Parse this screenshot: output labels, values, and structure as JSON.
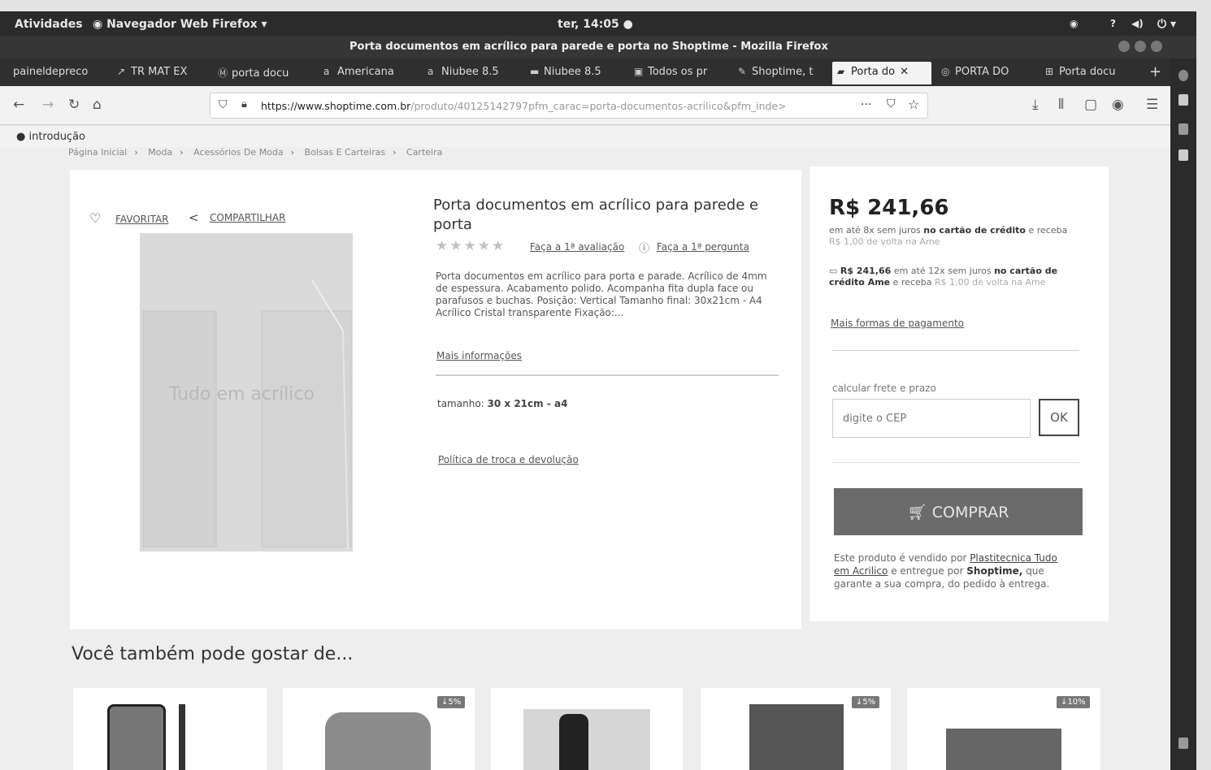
{
  "topbar": {
    "activities": "Atividades",
    "app_menu": "Navegador Web Firefox ▾",
    "clock": "ter, 14:05 ●"
  },
  "window": {
    "title": "Porta documentos em acrílico para parede e porta no Shoptime - Mozilla Firefox"
  },
  "tabs": [
    {
      "label": "paineldepreco",
      "icon": ""
    },
    {
      "label": "TR MAT EX",
      "icon": "↗"
    },
    {
      "label": "porta docu",
      "icon": "Ⓜ"
    },
    {
      "label": "Americana",
      "icon": "a"
    },
    {
      "label": "Niubee 8.5",
      "icon": "a"
    },
    {
      "label": "Niubee 8.5",
      "icon": "▬"
    },
    {
      "label": "Todos os pr",
      "icon": "▣"
    },
    {
      "label": "Shoptime, t",
      "icon": "✎"
    },
    {
      "label": "Porta do",
      "icon": "▰"
    },
    {
      "label": "PORTA DO",
      "icon": "◎"
    },
    {
      "label": "Porta docu",
      "icon": "⊞"
    }
  ],
  "navbar": {
    "url_main": "https://www.shoptime.com.br",
    "url_rest": "/produto/40125142797pfm_carac=porta-documentos-acrilico&pfm_inde>",
    "more": "···"
  },
  "bookmarks": {
    "item": "introdução"
  },
  "breadcrumb": [
    "Página Inicial",
    "Moda",
    "Acessórios De Moda",
    "Bolsas E Carteiras",
    "Carteira"
  ],
  "product": {
    "favorite": "FAVORITAR",
    "share": "COMPARTILHAR",
    "watermark": "Tudo em acrílico",
    "title": "Porta documentos em acrílico para parede e porta",
    "stars": "★★★★★",
    "review_link": "Faça a 1ª avaliação",
    "question_link": "Faça a 1ª pergunta",
    "description": "Porta documentos em acrílico para porta e parade. Acrílico de 4mm de espessura. Acabamento polido. Acompanha fita dupla face ou parafusos e buchas. Posição: Vertical Tamanho final: 30x21cm - A4 Acrílico Cristal transparente Fixação:...",
    "more_info": "Mais informações",
    "size_label": "tamanho:",
    "size_value": "30 x 21cm - a4",
    "policy": "Política de troca e devolução"
  },
  "buy": {
    "price": "R$ 241,66",
    "installments_a": "em até 8x sem juros",
    "installments_b": "no cartão de crédito",
    "installments_c": "e receba",
    "cashback_a": "R$ 1,00 de volta na Ame",
    "ame_price": "R$ 241,66",
    "ame_a": "em até 12x sem juros",
    "ame_b": "no cartão de crédito Ame",
    "ame_c": "e receba",
    "cashback_b": "R$ 1,00 de volta na Ame",
    "more_payment": "Mais formas de pagamento",
    "cep_label": "calcular frete e prazo",
    "cep_placeholder": "digite o CEP",
    "ok": "OK",
    "buy_button": "COMPRAR",
    "seller_a": "Este produto é vendido por",
    "seller_name": "Plastitecnica Tudo em Acrilico",
    "seller_b": "e entregue por",
    "seller_shop": "Shoptime,",
    "seller_c": "que garante a sua compra, do pedido à entrega."
  },
  "recommendations": {
    "title": "Você também pode gostar de...",
    "badges": [
      "↓5%",
      "↓5%",
      "↓10%"
    ]
  },
  "colors": {
    "topbar": "#2b2b2b",
    "buy_button": "#6b6b6b",
    "page_bg": "#eeeeee"
  }
}
